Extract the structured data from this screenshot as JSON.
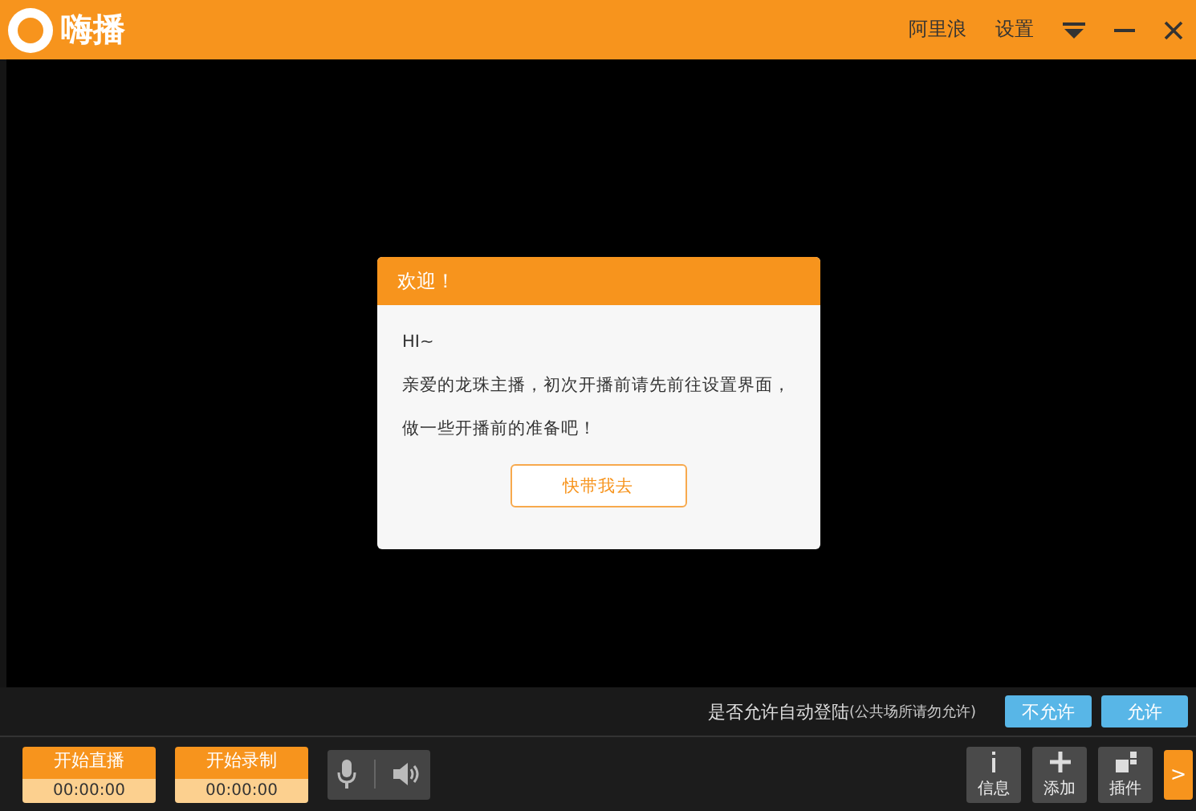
{
  "titlebar": {
    "logo": "嗨播",
    "links": [
      "阿里浪",
      "设置"
    ]
  },
  "dialog": {
    "title": "欢迎！",
    "lines": [
      "HI~",
      "亲爱的龙珠主播，初次开播前请先前往设置界面，",
      "做一些开播前的准备吧！"
    ],
    "button": "快带我去"
  },
  "login_prompt": {
    "text": "是否允许自动登陆",
    "note": "(公共场所请勿允许)",
    "buttons": [
      "不允许",
      "允许"
    ]
  },
  "controls": [
    {
      "label": "开始直播",
      "time": "00:00:00"
    },
    {
      "label": "开始录制",
      "time": "00:00:00"
    }
  ],
  "tools": [
    {
      "kind": "info",
      "label": "信息"
    },
    {
      "kind": "add",
      "label": "添加"
    },
    {
      "kind": "plugin",
      "label": "插件"
    }
  ],
  "expand": ">"
}
